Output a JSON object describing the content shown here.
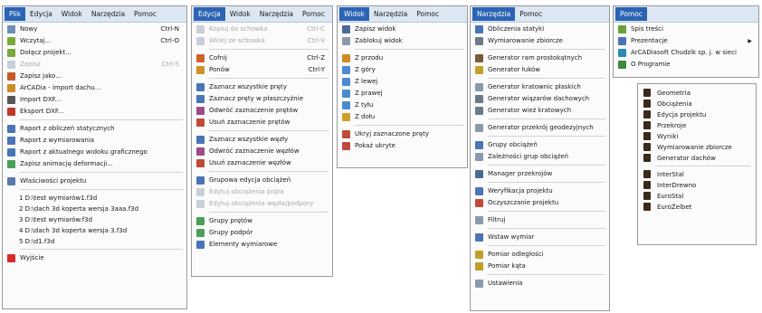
{
  "colors": {
    "menubar": "#dce7f3",
    "active": "#2b64b4",
    "disabled": "#a8a8a8"
  },
  "panels": [
    {
      "menubar": [
        "Plik",
        "Edycja",
        "Widok",
        "Narzędzia",
        "Pomoc"
      ],
      "active": 0,
      "items": [
        {
          "label": "Nowy",
          "shortcut": "Ctrl-N",
          "icon": "new-file-icon",
          "color": "#6d8fb8"
        },
        {
          "label": "Wczytaj...",
          "shortcut": "Ctrl-O",
          "icon": "open-folder-icon",
          "color": "#7aa83c"
        },
        {
          "label": "Dołącz projekt...",
          "icon": "attach-project-icon",
          "color": "#7aa83c"
        },
        {
          "label": "Zapisz",
          "shortcut": "Ctrl-S",
          "icon": "save-icon",
          "color": "#8a9aaa",
          "disabled": true
        },
        {
          "label": "Zapisz jako...",
          "icon": "save-as-icon",
          "color": "#c85a2a"
        },
        {
          "label": "ArCADia - import dachu...",
          "icon": "arcadia-roof-icon",
          "color": "#d08a2a"
        },
        {
          "label": "Import DXF...",
          "icon": "dxf-import-icon",
          "color": "#555555"
        },
        {
          "label": "Eksport DXF...",
          "icon": "dxf-export-icon",
          "color": "#c0392b"
        },
        {
          "sep": true
        },
        {
          "label": "Raport z obliczeń statycznych",
          "icon": "report-icon",
          "color": "#4a74b6"
        },
        {
          "label": "Raport z wymiarowania",
          "icon": "report-icon",
          "color": "#4a74b6"
        },
        {
          "label": "Raport z aktualnego widoku graficznego",
          "icon": "report-view-icon",
          "color": "#4a74b6"
        },
        {
          "label": "Zapisz animację deformacji...",
          "icon": "animation-icon",
          "color": "#4aa05a"
        },
        {
          "sep": true
        },
        {
          "label": "Właściwości projektu",
          "icon": "properties-icon",
          "color": "#5a7aa8"
        },
        {
          "sep": true
        },
        {
          "label": "1 D:\\test wymiarów1.f3d",
          "recent": true
        },
        {
          "label": "2 D:\\dach 3d koperta wersja 3aaa.f3d",
          "recent": true
        },
        {
          "label": "3 D:\\test wymiarów.f3d",
          "recent": true
        },
        {
          "label": "4 D:\\dach 3d koperta wersja 3.f3d",
          "recent": true
        },
        {
          "label": "5 D:\\d1.f3d",
          "recent": true
        },
        {
          "sep": true
        },
        {
          "label": "Wyjście",
          "icon": "exit-icon",
          "color": "#d62a2a"
        }
      ]
    },
    {
      "menubar": [
        "Edycja",
        "Widok",
        "Narzędzia",
        "Pomoc"
      ],
      "active": 0,
      "items": [
        {
          "label": "Kopiuj do schowka",
          "shortcut": "Ctrl-C",
          "icon": "copy-icon",
          "color": "#8a9aaa",
          "disabled": true
        },
        {
          "label": "Wklej ze schowka",
          "shortcut": "Ctrl-V",
          "icon": "paste-icon",
          "color": "#8a9aaa",
          "disabled": true
        },
        {
          "sep": true
        },
        {
          "label": "Cofnij",
          "shortcut": "Ctrl-Z",
          "icon": "undo-icon",
          "color": "#d0602a"
        },
        {
          "label": "Ponów",
          "shortcut": "Ctrl-Y",
          "icon": "redo-icon",
          "color": "#d0902a"
        },
        {
          "sep": true
        },
        {
          "label": "Zaznacz wszystkie pręty",
          "icon": "select-bars-icon",
          "color": "#4a74b6"
        },
        {
          "label": "Zaznacz pręty w płaszczyźnie",
          "icon": "select-plane-icon",
          "color": "#4a74b6"
        },
        {
          "label": "Odwróć zaznaczenie prętów",
          "icon": "invert-bars-icon",
          "color": "#a04a8a"
        },
        {
          "label": "Usuń zaznaczenie prętów",
          "icon": "deselect-bars-icon",
          "color": "#c04a3a"
        },
        {
          "sep": true
        },
        {
          "label": "Zaznacz wszystkie węzły",
          "icon": "select-nodes-icon",
          "color": "#4a74b6"
        },
        {
          "label": "Odwróć zaznaczenie węzłów",
          "icon": "invert-nodes-icon",
          "color": "#a04a8a"
        },
        {
          "label": "Usuń zaznaczenie węzłów",
          "icon": "deselect-nodes-icon",
          "color": "#c04a3a"
        },
        {
          "sep": true
        },
        {
          "label": "Grupowa edycja obciążeń",
          "icon": "group-loads-icon",
          "color": "#4a74b6"
        },
        {
          "label": "Edytuj obciążenia pręta",
          "icon": "bar-loads-icon",
          "color": "#8a9aaa",
          "disabled": true
        },
        {
          "label": "Edytuj obciążenia węzła/podpory",
          "icon": "node-loads-icon",
          "color": "#8a9aaa",
          "disabled": true
        },
        {
          "sep": true
        },
        {
          "label": "Grupy prętów",
          "icon": "bar-groups-icon",
          "color": "#4aa05a"
        },
        {
          "label": "Grupy podpór",
          "icon": "support-groups-icon",
          "color": "#4aa05a"
        },
        {
          "label": "Elementy wymiarowe",
          "icon": "dimension-elements-icon",
          "color": "#4a74b6"
        }
      ]
    },
    {
      "menubar": [
        "Widok",
        "Narzędzia",
        "Pomoc"
      ],
      "active": 0,
      "items": [
        {
          "label": "Zapisz widok",
          "icon": "save-view-icon",
          "color": "#4a6a98"
        },
        {
          "label": "Zablokuj widok",
          "icon": "lock-view-icon",
          "color": "#8a9aaa"
        },
        {
          "sep": true
        },
        {
          "label": "Z przodu",
          "icon": "view-front-icon",
          "color": "#d08a2a"
        },
        {
          "label": "Z góry",
          "icon": "view-top-icon",
          "color": "#4a8ad0"
        },
        {
          "label": "Z lewej",
          "icon": "view-left-icon",
          "color": "#4a8ad0"
        },
        {
          "label": "Z prawej",
          "icon": "view-right-icon",
          "color": "#4a8ad0"
        },
        {
          "label": "Z tyłu",
          "icon": "view-back-icon",
          "color": "#4a8ad0"
        },
        {
          "label": "Z dołu",
          "icon": "view-bottom-icon",
          "color": "#d0a02a"
        },
        {
          "sep": true
        },
        {
          "label": "Ukryj zaznaczone pręty",
          "icon": "hide-bars-icon",
          "color": "#c04a3a"
        },
        {
          "label": "Pokaż ukryte",
          "icon": "show-hidden-icon",
          "color": "#c04a3a"
        }
      ]
    },
    {
      "menubar": [
        "Narzędzia",
        "Pomoc"
      ],
      "active": 0,
      "items": [
        {
          "label": "Obliczenia statyki",
          "icon": "statics-icon",
          "color": "#4a74b6"
        },
        {
          "label": "Wymiarowanie zbiorcze",
          "icon": "bulk-design-icon",
          "color": "#6a7a8a"
        },
        {
          "sep": true
        },
        {
          "label": "Generator ram prostokątnych",
          "icon": "frame-generator-icon",
          "color": "#7a5a3a"
        },
        {
          "label": "Generator łuków",
          "icon": "arch-generator-icon",
          "color": "#c0a02a"
        },
        {
          "sep": true
        },
        {
          "label": "Generator kratownic płaskich",
          "icon": "truss-generator-icon",
          "color": "#8a9aaa"
        },
        {
          "label": "Generator wiązarów dachowych",
          "icon": "rafter-generator-icon",
          "color": "#6a7a8a"
        },
        {
          "label": "Generator wież kratowych",
          "icon": "tower-generator-icon",
          "color": "#6a7a8a"
        },
        {
          "sep": true
        },
        {
          "label": "Generator przekrój geodezyjnych",
          "icon": "geodesic-generator-icon",
          "color": "#8a9aaa"
        },
        {
          "sep": true
        },
        {
          "label": "Grupy obciążeń",
          "icon": "load-groups-icon",
          "color": "#4a74b6"
        },
        {
          "label": "Zależności grup obciążeń",
          "icon": "load-dependencies-icon",
          "color": "#8a9aaa"
        },
        {
          "sep": true
        },
        {
          "label": "Manager przekrojów",
          "icon": "section-manager-icon",
          "color": "#4a6a98"
        },
        {
          "sep": true
        },
        {
          "label": "Weryfikacja projektu",
          "icon": "verify-icon",
          "color": "#4a74b6"
        },
        {
          "label": "Oczyszczanie projektu",
          "icon": "cleanup-icon",
          "color": "#c04a3a"
        },
        {
          "sep": true
        },
        {
          "label": "Filtruj",
          "icon": "filter-icon",
          "color": "#8a9aaa"
        },
        {
          "sep": true
        },
        {
          "label": "Wstaw wymiar",
          "icon": "insert-dimension-icon",
          "color": "#4a74b6"
        },
        {
          "sep": true
        },
        {
          "label": "Pomiar odległości",
          "icon": "measure-distance-icon",
          "color": "#c0a02a"
        },
        {
          "label": "Pomiar kąta",
          "icon": "measure-angle-icon",
          "color": "#c0a02a"
        },
        {
          "sep": true
        },
        {
          "label": "Ustawienia",
          "icon": "settings-icon",
          "color": "#8a9aaa"
        }
      ]
    },
    {
      "menubar": [
        "Pomoc"
      ],
      "active": 0,
      "items": [
        {
          "label": "Spis treści",
          "icon": "help-contents-icon",
          "color": "#6aa03a"
        },
        {
          "label": "Prezentacje",
          "icon": "presentations-icon",
          "color": "#4a74b6",
          "arrow": "▶"
        },
        {
          "label": "ArCADiasoft Chudzik sp. j. w sieci",
          "icon": "web-icon",
          "color": "#2a8ab8"
        },
        {
          "label": "O Programie",
          "icon": "about-icon",
          "color": "#3a8a3a"
        }
      ]
    }
  ],
  "submenu": {
    "items": [
      {
        "label": "Geometria"
      },
      {
        "label": "Obciążenia"
      },
      {
        "label": "Edycja projektu"
      },
      {
        "label": "Przekroje"
      },
      {
        "label": "Wyniki"
      },
      {
        "label": "Wymiarowanie zbiorcze"
      },
      {
        "label": "Generator dachów"
      },
      {
        "sep": true
      },
      {
        "label": "InterStal"
      },
      {
        "label": "InterDrewno"
      },
      {
        "label": "EuroStal"
      },
      {
        "label": "EuroŻelbet"
      }
    ]
  }
}
